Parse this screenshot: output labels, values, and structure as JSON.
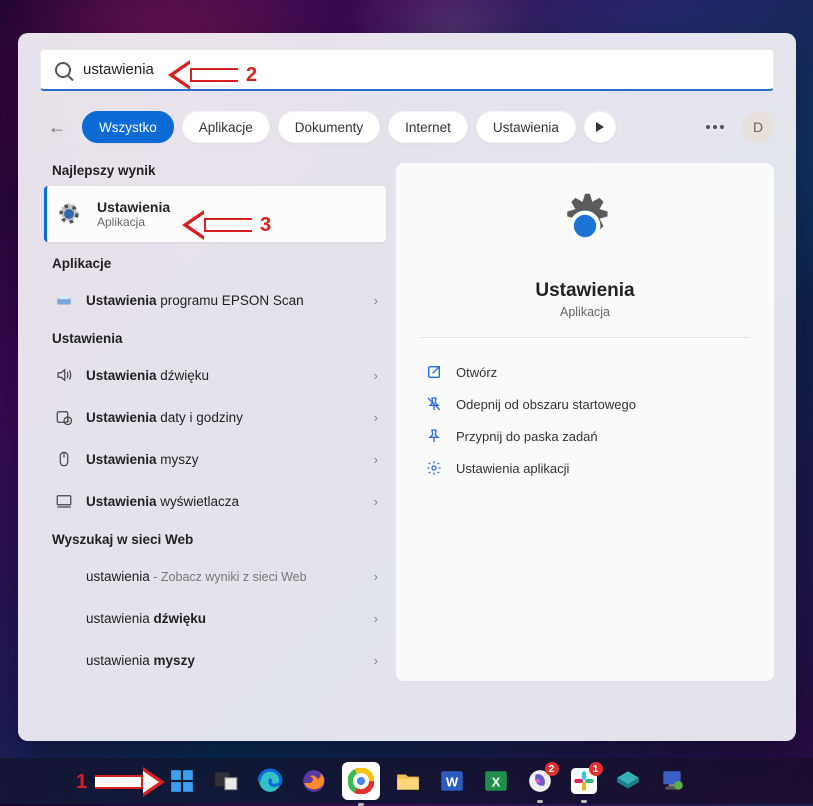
{
  "search": {
    "query": "ustawienia"
  },
  "filters": {
    "items": [
      "Wszystko",
      "Aplikacje",
      "Dokumenty",
      "Internet",
      "Ustawienia"
    ],
    "active_index": 0
  },
  "avatar_letter": "D",
  "sections": {
    "best_label": "Najlepszy wynik",
    "best": {
      "title": "Ustawienia",
      "subtitle": "Aplikacja"
    },
    "apps_label": "Aplikacje",
    "apps": [
      {
        "bold": "Ustawienia",
        "rest": " programu EPSON Scan"
      }
    ],
    "settings_label": "Ustawienia",
    "settings": [
      {
        "bold": "Ustawienia",
        "rest": " dźwięku"
      },
      {
        "bold": "Ustawienia",
        "rest": " daty i godziny"
      },
      {
        "bold": "Ustawienia",
        "rest": " myszy"
      },
      {
        "bold": "Ustawienia",
        "rest": " wyświetlacza"
      }
    ],
    "web_label": "Wyszukaj w sieci Web",
    "web": [
      {
        "prefix": "ustawienia",
        "suffix": " - Zobacz wyniki z sieci Web",
        "bold_suffix": ""
      },
      {
        "prefix": "ustawienia ",
        "suffix": "",
        "bold_suffix": "dźwięku"
      },
      {
        "prefix": "ustawienia ",
        "suffix": "",
        "bold_suffix": "myszy"
      }
    ]
  },
  "preview": {
    "title": "Ustawienia",
    "subtitle": "Aplikacja",
    "actions": [
      "Otwórz",
      "Odepnij od obszaru startowego",
      "Przypnij do paska zadań",
      "Ustawienia aplikacji"
    ]
  },
  "taskbar": {
    "badges": {
      "copilot": "2",
      "slack": "1"
    }
  },
  "annotations": {
    "n1": "1",
    "n2": "2",
    "n3": "3"
  }
}
